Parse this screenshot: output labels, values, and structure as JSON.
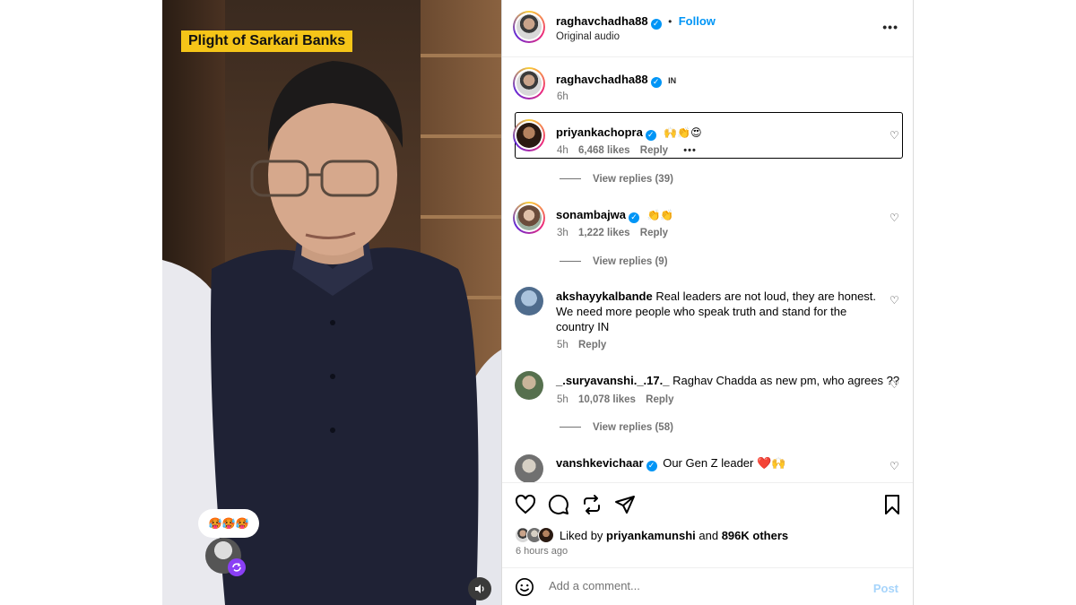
{
  "video": {
    "caption": "Plight of Sarkari Banks",
    "bubble_emojis": "🥵🥵🥵",
    "remix_icon": "remix-icon",
    "sound_icon": "speaker-icon"
  },
  "header": {
    "username": "raghavchadha88",
    "dot": "•",
    "follow": "Follow",
    "audio": "Original audio",
    "more": "•••"
  },
  "caption": {
    "username": "raghavchadha88",
    "flag": "IN",
    "time": "6h"
  },
  "comments": [
    {
      "username": "priyankachopra",
      "verified": true,
      "text": "🙌👏😍",
      "time": "4h",
      "likes": "6,468 likes",
      "reply": "Reply",
      "more": "•••",
      "view_replies": "View replies (39)"
    },
    {
      "username": "sonambajwa",
      "verified": true,
      "text": "👏👏",
      "time": "3h",
      "likes": "1,222 likes",
      "reply": "Reply",
      "view_replies": "View replies (9)"
    },
    {
      "username": "akshayykalbande",
      "verified": false,
      "text_line1": "Real leaders are not loud, they are honest.",
      "text_line2": "We need more people who speak truth and stand for the",
      "text_line3": "country IN",
      "time": "5h",
      "reply": "Reply"
    },
    {
      "username": "_.suryavanshi._.17._",
      "verified": false,
      "text": "Raghav Chadda as new pm, who agrees ??",
      "time": "5h",
      "likes": "10,078 likes",
      "reply": "Reply",
      "view_replies": "View replies (58)"
    },
    {
      "username": "vanshkevichaar",
      "verified": true,
      "text": "Our Gen Z leader ❤️🙌"
    }
  ],
  "actions": {
    "liked_by_prefix": "Liked by",
    "liked_by_user": "priyankamunshi",
    "and": "and",
    "others": "896K others",
    "time_ago": "6 hours ago"
  },
  "add_comment": {
    "placeholder": "Add a comment...",
    "post": "Post"
  }
}
